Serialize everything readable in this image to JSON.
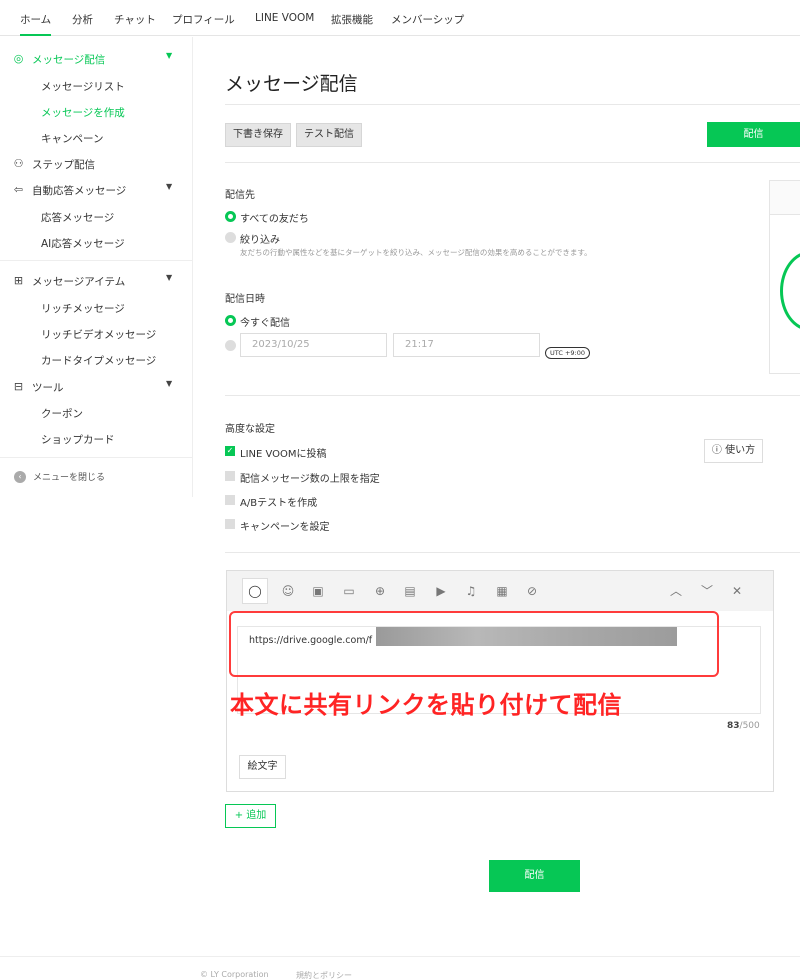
{
  "topnav": {
    "tabs": [
      {
        "label": "ホーム",
        "active": true
      },
      {
        "label": "分析"
      },
      {
        "label": "チャット"
      },
      {
        "label": "プロフィール"
      },
      {
        "label": "LINE VOOM"
      },
      {
        "label": "拡張機能"
      },
      {
        "label": "メンバーシップ"
      }
    ]
  },
  "sidebar": {
    "items": [
      {
        "label": "メッセージ配信",
        "icon": "broadcast-icon"
      },
      {
        "label": "メッセージリスト"
      },
      {
        "label": "メッセージを作成"
      },
      {
        "label": "キャンペーン"
      },
      {
        "label": "ステップ配信",
        "icon": "hierarchy-icon"
      },
      {
        "label": "自動応答メッセージ",
        "icon": "reply-icon"
      },
      {
        "label": "応答メッセージ"
      },
      {
        "label": "AI応答メッセージ"
      },
      {
        "label": "メッセージアイテム",
        "icon": "message-item-icon"
      },
      {
        "label": "リッチメッセージ"
      },
      {
        "label": "リッチビデオメッセージ"
      },
      {
        "label": "カードタイプメッセージ"
      },
      {
        "label": "ツール",
        "icon": "toolbox-icon"
      },
      {
        "label": "クーポン"
      },
      {
        "label": "ショップカード"
      }
    ],
    "close_menu": "メニューを閉じる"
  },
  "main": {
    "title": "メッセージ配信",
    "draft_save": "下書き保存",
    "test_send": "テスト配信",
    "send_top": "配信",
    "recipients": {
      "label": "配信先",
      "option_all": "すべての友だち",
      "option_filter": "絞り込み",
      "filter_hint": "友だちの行動や属性などを基にターゲットを絞り込み、メッセージ配信の効果を高めることができます。"
    },
    "schedule": {
      "label": "配信日時",
      "option_now": "今すぐ配信",
      "date": "2023/10/25",
      "time": "21:17",
      "timezone": "UTC +9:00"
    },
    "advanced": {
      "label": "高度な設定",
      "howto": "使い方",
      "options": [
        {
          "label": "LINE VOOMに投稿",
          "checked": true
        },
        {
          "label": "配信メッセージ数の上限を指定",
          "checked": false
        },
        {
          "label": "A/Bテストを作成",
          "checked": false
        },
        {
          "label": "キャンペーンを設定",
          "checked": false
        }
      ]
    },
    "editor": {
      "text": "https://drive.google.com/f",
      "count": "83",
      "max": "/500",
      "emoji_button": "絵文字"
    },
    "annotation": "本文に共有リンクを貼り付けて配信",
    "add_button": "+ 追加",
    "send_bottom": "配信"
  },
  "footer": {
    "copyright": "© LY Corporation",
    "policy": "規約とポリシー"
  },
  "colors": {
    "accent": "#06c755",
    "annotation": "#ff2424"
  }
}
